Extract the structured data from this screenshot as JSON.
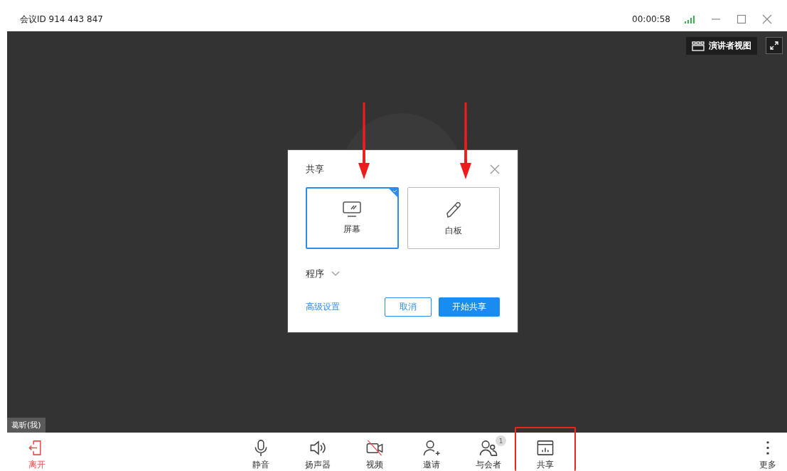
{
  "title_bar": {
    "meeting_id": "会议ID 914 443 847",
    "timer": "00:00:58"
  },
  "stage": {
    "presenter_view": "演讲者视图",
    "name_tag": "葛昕(我)"
  },
  "share_dialog": {
    "title": "共享",
    "options": [
      {
        "kind": "screen",
        "label": "屏幕",
        "selected": true
      },
      {
        "kind": "whiteboard",
        "label": "白板",
        "selected": false
      }
    ],
    "program_dropdown": "程序",
    "advanced_link": "高级设置",
    "cancel": "取消",
    "start": "开始共享"
  },
  "toolbar": [
    {
      "kind": "leave",
      "label": "离开",
      "off": false,
      "highlighted": false
    },
    {
      "kind": "mic",
      "label": "静音",
      "off": false,
      "highlighted": false
    },
    {
      "kind": "speaker",
      "label": "扬声器",
      "off": false,
      "highlighted": false
    },
    {
      "kind": "camera",
      "label": "视频",
      "off": true,
      "highlighted": false
    },
    {
      "kind": "invite",
      "label": "邀请",
      "off": false,
      "highlighted": false
    },
    {
      "kind": "participants",
      "label": "与会者",
      "badge": "1",
      "off": false,
      "highlighted": false
    },
    {
      "kind": "share",
      "label": "共享",
      "off": false,
      "highlighted": true
    },
    {
      "kind": "more",
      "label": "更多",
      "off": false,
      "highlighted": false
    }
  ]
}
